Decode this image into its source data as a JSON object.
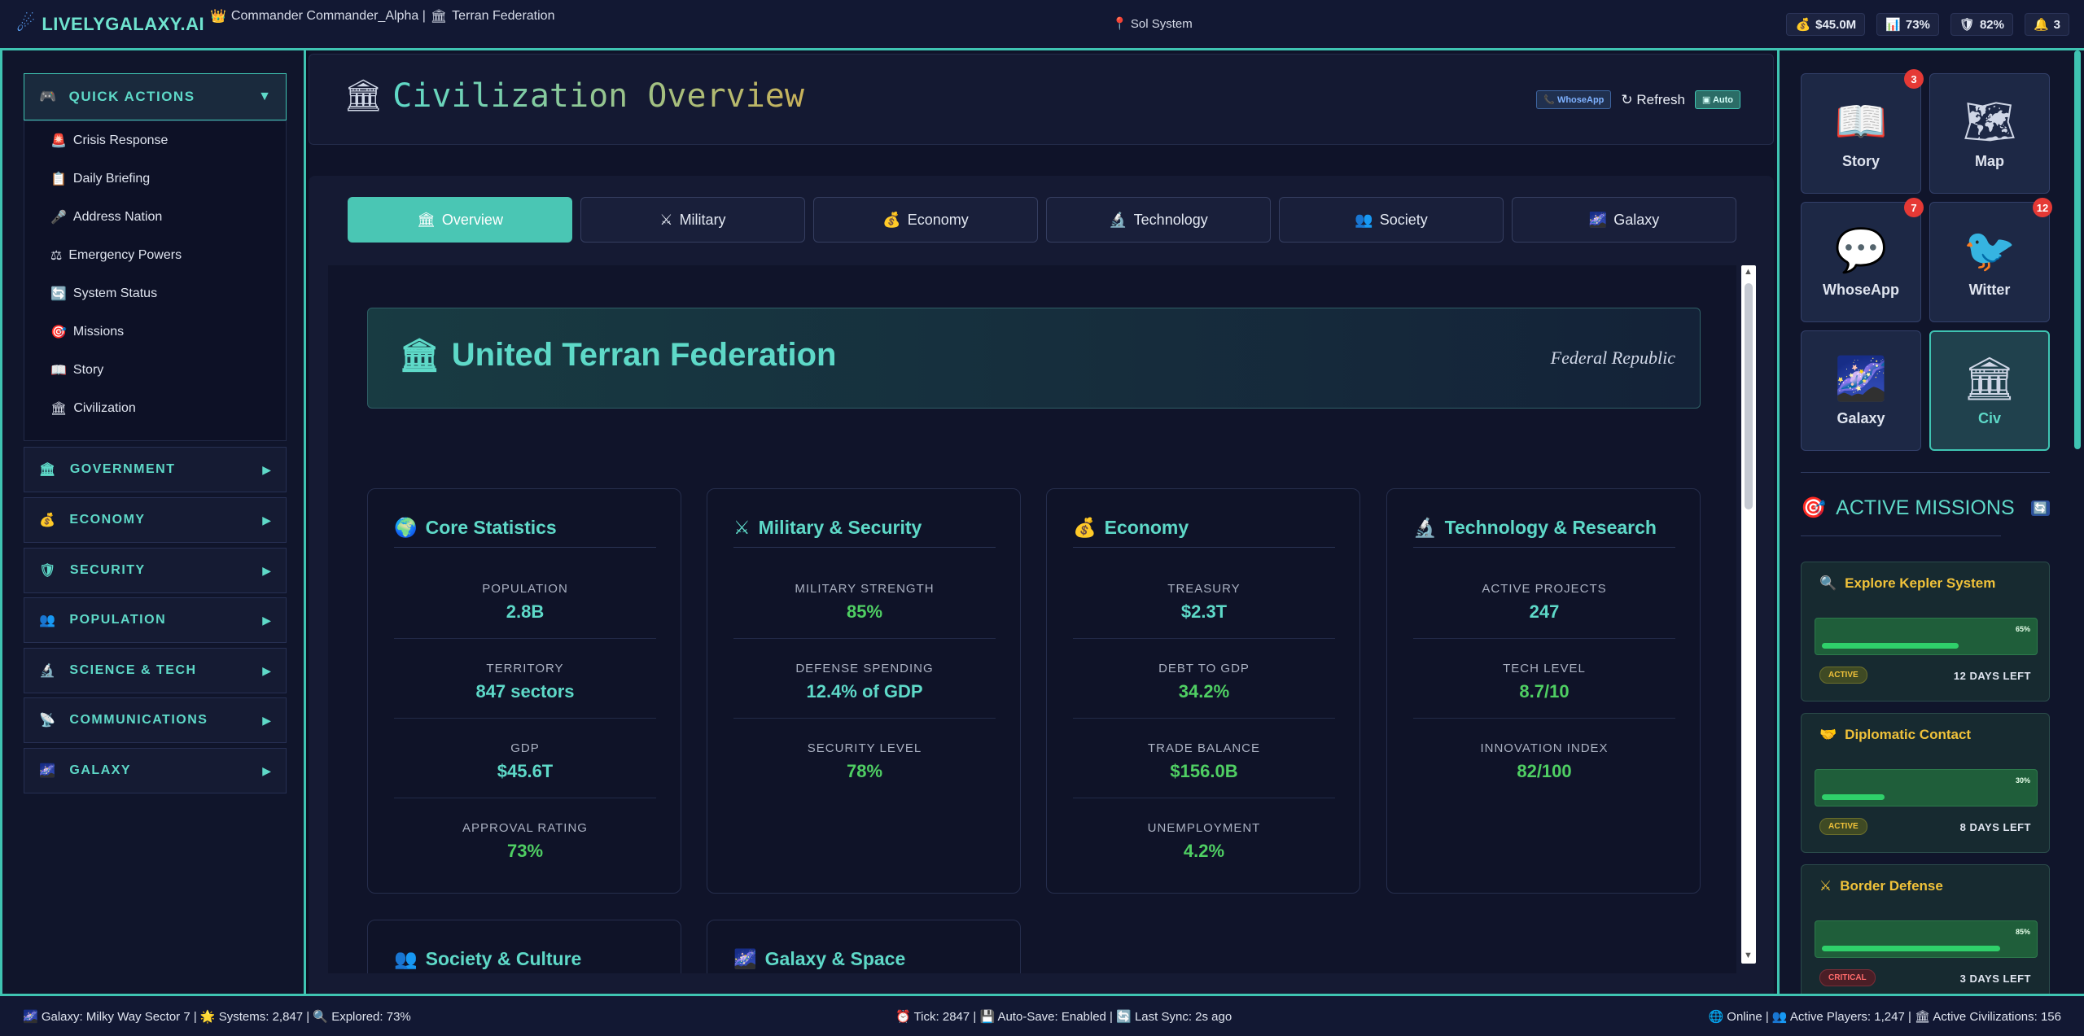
{
  "app": {
    "logo_icon": "☄",
    "title": "LIVELYGALAXY.AI"
  },
  "topbar": {
    "commander_icon": "👑",
    "commander": "Commander Commander_Alpha |",
    "faction_icon": "🏛",
    "faction": "Terran Federation",
    "location_icon": "📍",
    "location": "Sol System",
    "stats": [
      {
        "icon": "💰",
        "value": "$45.0M"
      },
      {
        "icon": "📊",
        "value": "73%"
      },
      {
        "icon": "🛡",
        "value": "82%"
      },
      {
        "icon": "🔔",
        "value": "3"
      }
    ]
  },
  "sidebar": {
    "quick_actions": {
      "icon": "🎮",
      "label": "QUICK ACTIONS",
      "arrow": "▼"
    },
    "items": [
      {
        "icon": "🚨",
        "label": "Crisis Response"
      },
      {
        "icon": "📋",
        "label": "Daily Briefing"
      },
      {
        "icon": "🎤",
        "label": "Address Nation"
      },
      {
        "icon": "⚖",
        "label": "Emergency Powers"
      },
      {
        "icon": "🔄",
        "label": "System Status"
      },
      {
        "icon": "🎯",
        "label": "Missions"
      },
      {
        "icon": "📖",
        "label": "Story"
      },
      {
        "icon": "🏛",
        "label": "Civilization"
      }
    ],
    "sections": [
      {
        "icon": "🏛",
        "label": "GOVERNMENT",
        "arrow": "▶"
      },
      {
        "icon": "💰",
        "label": "ECONOMY",
        "arrow": "▶"
      },
      {
        "icon": "🛡",
        "label": "SECURITY",
        "arrow": "▶"
      },
      {
        "icon": "👥",
        "label": "POPULATION",
        "arrow": "▶"
      },
      {
        "icon": "🔬",
        "label": "SCIENCE & TECH",
        "arrow": "▶"
      },
      {
        "icon": "📡",
        "label": "COMMUNICATIONS",
        "arrow": "▶"
      },
      {
        "icon": "🌌",
        "label": "GALAXY",
        "arrow": "▶"
      }
    ]
  },
  "header": {
    "icon": "🏛",
    "title": "Civilization Overview",
    "whoseapp_label": "📞 WhoseApp",
    "refresh_label": "↻ Refresh",
    "auto_label": "▣ Auto"
  },
  "tabs": [
    {
      "icon": "🏛",
      "label": "Overview"
    },
    {
      "icon": "⚔",
      "label": "Military"
    },
    {
      "icon": "💰",
      "label": "Economy"
    },
    {
      "icon": "🔬",
      "label": "Technology"
    },
    {
      "icon": "👥",
      "label": "Society"
    },
    {
      "icon": "🌌",
      "label": "Galaxy"
    }
  ],
  "civ": {
    "icon": "🏛",
    "name": "United Terran Federation",
    "government": "Federal Republic"
  },
  "cards": [
    {
      "icon": "🌍",
      "title": "Core Statistics",
      "rows": [
        {
          "label": "POPULATION",
          "value": "2.8B"
        },
        {
          "label": "TERRITORY",
          "value": "847 sectors"
        },
        {
          "label": "GDP",
          "value": "$45.6T"
        },
        {
          "label": "APPROVAL RATING",
          "value": "73%"
        }
      ]
    },
    {
      "icon": "⚔",
      "title": "Military & Security",
      "rows": [
        {
          "label": "MILITARY STRENGTH",
          "value": "85%"
        },
        {
          "label": "DEFENSE SPENDING",
          "value": "12.4% of GDP"
        },
        {
          "label": "SECURITY LEVEL",
          "value": "78%"
        }
      ]
    },
    {
      "icon": "💰",
      "title": "Economy",
      "rows": [
        {
          "label": "TREASURY",
          "value": "$2.3T"
        },
        {
          "label": "DEBT TO GDP",
          "value": "34.2%"
        },
        {
          "label": "TRADE BALANCE",
          "value": "$156.0B"
        },
        {
          "label": "UNEMPLOYMENT",
          "value": "4.2%"
        }
      ]
    },
    {
      "icon": "🔬",
      "title": "Technology & Research",
      "rows": [
        {
          "label": "ACTIVE PROJECTS",
          "value": "247"
        },
        {
          "label": "TECH LEVEL",
          "value": "8.7/10"
        },
        {
          "label": "INNOVATION INDEX",
          "value": "82/100"
        }
      ]
    }
  ],
  "cards_more": [
    {
      "icon": "👥",
      "title": "Society & Culture"
    },
    {
      "icon": "🌌",
      "title": "Galaxy & Space"
    }
  ],
  "apps": [
    {
      "icon": "📖",
      "label": "Story",
      "badge": "3"
    },
    {
      "icon": "🗺",
      "label": "Map",
      "badge": ""
    },
    {
      "icon": "💬",
      "label": "WhoseApp",
      "badge": "7"
    },
    {
      "icon": "🐦",
      "label": "Witter",
      "badge": "12"
    },
    {
      "icon": "🌌",
      "label": "Galaxy",
      "badge": ""
    },
    {
      "icon": "🏛",
      "label": "Civ",
      "badge": ""
    }
  ],
  "missions_panel": {
    "icon": "🎯",
    "title": "ACTIVE MISSIONS",
    "sync_icon": "🔄"
  },
  "missions": [
    {
      "icon": "🔍",
      "title": "Explore Kepler System",
      "progress_label": "65%",
      "progress": 0.65,
      "status": "ACTIVE",
      "time_left": "12 DAYS LEFT"
    },
    {
      "icon": "🤝",
      "title": "Diplomatic Contact",
      "progress_label": "30%",
      "progress": 0.3,
      "status": "ACTIVE",
      "time_left": "8 DAYS LEFT"
    },
    {
      "icon": "⚔",
      "title": "Border Defense",
      "progress_label": "85%",
      "progress": 0.85,
      "status": "CRITICAL",
      "time_left": "3 DAYS LEFT"
    }
  ],
  "footer": {
    "left": "🌌 Galaxy: Milky Way Sector 7 | 🌟 Systems: 2,847 | 🔍 Explored: 73%",
    "center": "⏰ Tick: 2847 | 💾 Auto-Save: Enabled | 🔄 Last Sync: 2s ago",
    "right": "🌐 Online | 👥 Active Players: 1,247 | 🏛 Active Civilizations: 156"
  }
}
